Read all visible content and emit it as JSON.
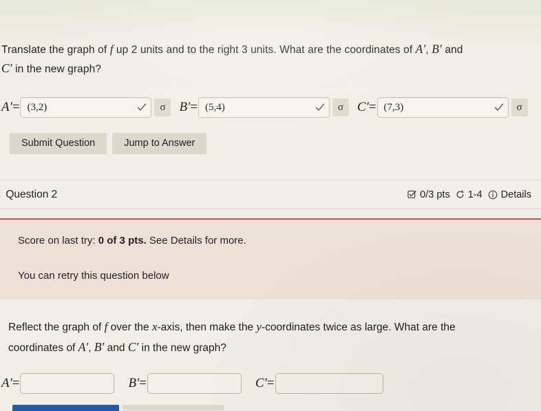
{
  "question1": {
    "prompt_part1": "Translate the graph of ",
    "prompt_f": "f",
    "prompt_part2": " up 2 units and to the right 3 units. What are the coordinates of ",
    "prompt_a": "A′",
    "prompt_comma": ", ",
    "prompt_b": "B′",
    "prompt_and": " and",
    "prompt_c": "C′",
    "prompt_part3": " in the new graph?",
    "answers": [
      {
        "label": "A′",
        "equals": "=",
        "value": "(3,2)",
        "status": "correct",
        "status_icon": "check-icon",
        "palette_icon": "sigma-icon",
        "palette_glyph": "σ"
      },
      {
        "label": "B′",
        "equals": "=",
        "value": "(5,4)",
        "status": "correct",
        "status_icon": "check-icon",
        "palette_icon": "sigma-icon",
        "palette_glyph": "σ"
      },
      {
        "label": "C′",
        "equals": "=",
        "value": "(7,3)",
        "status": "correct",
        "status_icon": "check-icon",
        "palette_icon": "sigma-icon",
        "palette_glyph": "σ"
      }
    ],
    "buttons": {
      "submit": "Submit Question",
      "jump": "Jump to Answer"
    }
  },
  "question_bar": {
    "back_icon": "chevron-left-icon",
    "title": "Question 2",
    "score_icon": "checkbox-icon",
    "score": "0/3 pts",
    "attempts_icon": "retry-icon",
    "attempts": "1-4",
    "details_icon": "info-icon",
    "details": "Details"
  },
  "score_box": {
    "prefix": "Score on last try: ",
    "emphasis": "0 of 3 pts.",
    "suffix": " See Details for more.",
    "retry": "You can retry this question below",
    "accent_color": "#d9534f",
    "background_color": "#ece0d8"
  },
  "question2": {
    "prompt_part1": "Reflect the graph of ",
    "prompt_f": "f",
    "prompt_part2": " over the ",
    "prompt_x": "x",
    "prompt_part3": "-axis, then make the ",
    "prompt_y": "y",
    "prompt_part4": "-coordinates twice as large. What are the",
    "prompt_line2_part1": "coordinates of ",
    "prompt_a": "A′",
    "prompt_comma": ", ",
    "prompt_b": "B′",
    "prompt_and": " and ",
    "prompt_c": "C′",
    "prompt_line2_part2": " in the new graph?",
    "answers": [
      {
        "label": "A′",
        "equals": "=",
        "value": ""
      },
      {
        "label": "B′",
        "equals": "=",
        "value": ""
      },
      {
        "label": "C′",
        "equals": "=",
        "value": ""
      }
    ]
  },
  "bottom_bar": {
    "primary_color": "#2458a8",
    "secondary_color": "#dcd8cc"
  }
}
